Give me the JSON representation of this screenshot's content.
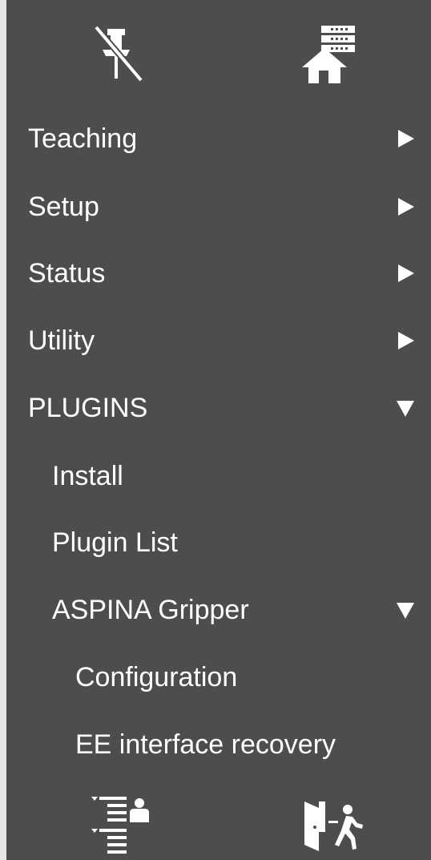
{
  "toolbar_top": {
    "unpin_icon": "unpin-icon",
    "home_server_icon": "home-server-icon"
  },
  "menu": {
    "teaching": {
      "label": "Teaching",
      "expanded": false
    },
    "setup": {
      "label": "Setup",
      "expanded": false
    },
    "status": {
      "label": "Status",
      "expanded": false
    },
    "utility": {
      "label": "Utility",
      "expanded": false
    },
    "plugins": {
      "label": "PLUGINS",
      "expanded": true,
      "install": {
        "label": "Install"
      },
      "plugin_list": {
        "label": "Plugin List"
      },
      "aspina_gripper": {
        "label": "ASPINA Gripper",
        "expanded": true,
        "configuration": {
          "label": "Configuration"
        },
        "ee_interface_recovery": {
          "label": "EE interface recovery"
        }
      }
    }
  },
  "toolbar_bottom": {
    "user_list_icon": "user-list-icon",
    "exit_icon": "exit-icon"
  },
  "colors": {
    "panel_bg": "#4d4d4d",
    "edge_bg": "#e6e6e6",
    "text": "#ffffff"
  }
}
